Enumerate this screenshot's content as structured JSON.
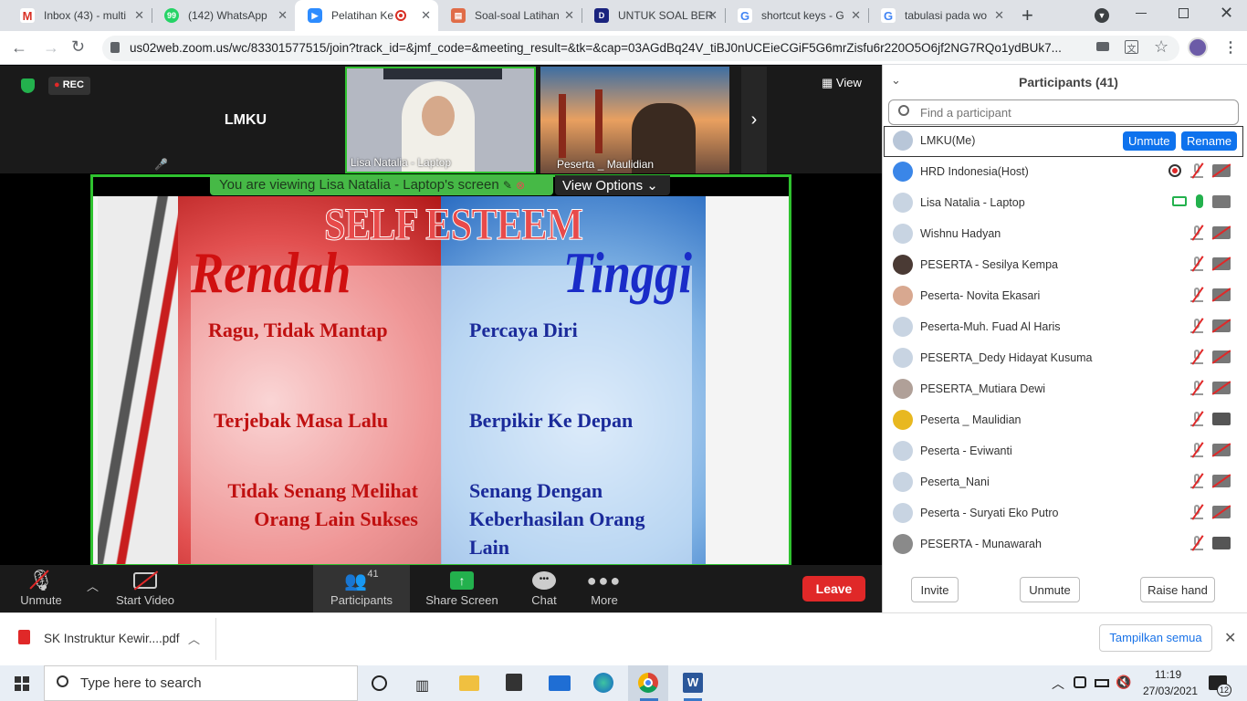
{
  "browser": {
    "tabs": [
      {
        "label": "Inbox (43) - multi",
        "icon": "gmail-icon",
        "color": "#ffffff"
      },
      {
        "label": "(142) WhatsApp",
        "icon": "whatsapp-icon",
        "color": "#25d366"
      },
      {
        "label": "Pelatihan Ke",
        "icon": "zoom-icon",
        "color": "#2d8cff"
      },
      {
        "label": "Soal-soal Latihan",
        "icon": "forms-icon",
        "color": "#e06c48"
      },
      {
        "label": "UNTUK SOAL BER",
        "icon": "doc-icon",
        "color": "#1a237e"
      },
      {
        "label": "shortcut keys - G",
        "icon": "google-icon",
        "color": "#ffffff"
      },
      {
        "label": "tabulasi pada wo",
        "icon": "google-icon",
        "color": "#ffffff"
      }
    ],
    "url": "us02web.zoom.us/wc/83301577515/join?track_id=&jmf_code=&meeting_result=&tk=&cap=03AGdBq24V_tiBJ0nUCEieCGiF5G6mrZisfu6r220O5O6jf2NG7RQo1ydBUk7..."
  },
  "meeting": {
    "rec": "REC",
    "view_label": "View",
    "self_tile": "LMKU",
    "video_tiles": [
      "Lisa Natalia - Laptop",
      "Peserta _ Maulidian"
    ],
    "banner": "You are viewing Lisa Natalia - Laptop's screen",
    "view_options": "View Options"
  },
  "slide": {
    "title": "SELF ESTEEM",
    "left_heading": "Rendah",
    "right_heading": "Tinggi",
    "left_items": [
      "Ragu, Tidak Mantap",
      "Terjebak Masa Lalu",
      "Tidak Senang Melihat Orang Lain Sukses"
    ],
    "right_items": [
      "Percaya Diri",
      "Berpikir Ke Depan",
      "Senang Dengan Keberhasilan Orang Lain"
    ]
  },
  "toolbar": {
    "unmute": "Unmute",
    "start_video": "Start Video",
    "participants": "Participants",
    "participants_count": "41",
    "share_screen": "Share Screen",
    "chat": "Chat",
    "more": "More",
    "leave": "Leave"
  },
  "participants": {
    "title": "Participants (41)",
    "search_placeholder": "Find a participant",
    "unmute_btn": "Unmute",
    "rename_btn": "Rename",
    "list": [
      "LMKU(Me)",
      "HRD Indonesia(Host)",
      "Lisa Natalia - Laptop",
      "Wishnu Hadyan",
      "PESERTA - Sesilya Kempa",
      "Peserta- Novita Ekasari",
      "Peserta-Muh. Fuad Al Haris",
      "PESERTA_Dedy Hidayat Kusuma",
      "PESERTA_Mutiara Dewi",
      "Peserta _ Maulidian",
      "Peserta - Eviwanti",
      "Peserta_Nani",
      "Peserta - Suryati Eko Putro",
      "PESERTA - Munawarah"
    ],
    "invite": "Invite",
    "unmute_all": "Unmute",
    "raise_hand": "Raise hand"
  },
  "downloads": {
    "file": "SK Instruktur Kewir....pdf",
    "show_all": "Tampilkan semua"
  },
  "taskbar": {
    "search": "Type here to search",
    "time": "11:19",
    "date": "27/03/2021",
    "notif": "12"
  }
}
